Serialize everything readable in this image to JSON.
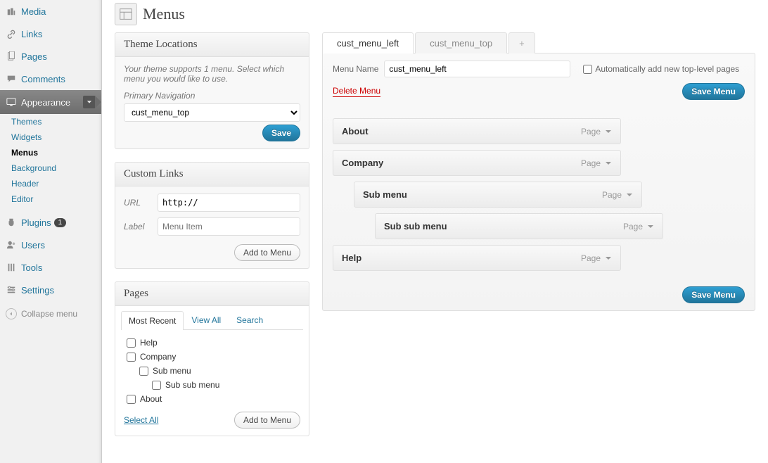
{
  "page_title": "Menus",
  "sidebar": {
    "items": [
      {
        "label": "Media"
      },
      {
        "label": "Links"
      },
      {
        "label": "Pages"
      },
      {
        "label": "Comments"
      },
      {
        "label": "Appearance",
        "active": true,
        "sub": [
          {
            "label": "Themes"
          },
          {
            "label": "Widgets"
          },
          {
            "label": "Menus",
            "current": true
          },
          {
            "label": "Background"
          },
          {
            "label": "Header"
          },
          {
            "label": "Editor"
          }
        ]
      },
      {
        "label": "Plugins",
        "badge": "1"
      },
      {
        "label": "Users"
      },
      {
        "label": "Tools"
      },
      {
        "label": "Settings"
      }
    ],
    "collapse": "Collapse menu"
  },
  "theme_locations": {
    "title": "Theme Locations",
    "desc": "Your theme supports 1 menu. Select which menu you would like to use.",
    "primary_label": "Primary Navigation",
    "selected": "cust_menu_top",
    "save": "Save"
  },
  "custom_links": {
    "title": "Custom Links",
    "url_label": "URL",
    "url_value": "http://",
    "label_label": "Label",
    "label_placeholder": "Menu Item",
    "add": "Add to Menu"
  },
  "pages_box": {
    "title": "Pages",
    "tabs": [
      "Most Recent",
      "View All",
      "Search"
    ],
    "list": [
      {
        "label": "Help",
        "indent": 0
      },
      {
        "label": "Company",
        "indent": 0
      },
      {
        "label": "Sub menu",
        "indent": 1
      },
      {
        "label": "Sub sub menu",
        "indent": 2
      },
      {
        "label": "About",
        "indent": 0
      }
    ],
    "select_all": "Select All",
    "add": "Add to Menu"
  },
  "menu_editor": {
    "tabs": [
      {
        "label": "cust_menu_left",
        "active": true
      },
      {
        "label": "cust_menu_top",
        "active": false
      }
    ],
    "name_label": "Menu Name",
    "name_value": "cust_menu_left",
    "auto_label": "Automatically add new top-level pages",
    "delete": "Delete Menu",
    "save": "Save Menu",
    "item_type": "Page",
    "items": [
      {
        "title": "About",
        "indent": 0
      },
      {
        "title": "Company",
        "indent": 0
      },
      {
        "title": "Sub menu",
        "indent": 1
      },
      {
        "title": "Sub sub menu",
        "indent": 2
      },
      {
        "title": "Help",
        "indent": 0
      }
    ]
  }
}
